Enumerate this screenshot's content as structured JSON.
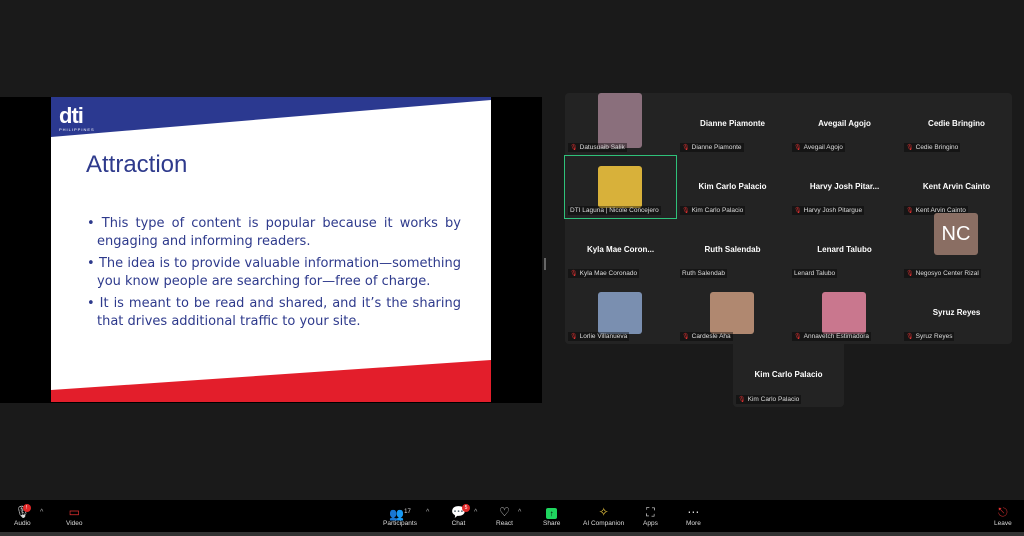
{
  "slide": {
    "logo": "dti",
    "logo_sub": "PHILIPPINES",
    "title": "Attraction",
    "bullets": [
      "This type of content is popular because it works by engaging and informing readers.",
      "The idea is to provide valuable information—something you know people are searching for—free of charge.",
      "It is meant to be read and shared, and it’s the sharing that drives additional traffic to your site."
    ]
  },
  "gallery": [
    {
      "big": "",
      "label": "Datusuaib Salik",
      "muted": true,
      "photo": "#8a6f7c"
    },
    {
      "big": "Dianne Piamonte",
      "label": "Dianne Piamonte",
      "muted": true
    },
    {
      "big": "Avegail Agojo",
      "label": "Avegail Agojo",
      "muted": true
    },
    {
      "big": "Cedie Bringino",
      "label": "Cedie Bringino",
      "muted": true
    },
    {
      "big": "",
      "label": "DTI Laguna | Nicole Concejero",
      "muted": false,
      "photo": "#d8b13a",
      "active": true
    },
    {
      "big": "Kim Carlo Palacio",
      "label": "Kim Carlo Palacio",
      "muted": true
    },
    {
      "big": "Harvy Josh Pitar...",
      "label": "Harvy Josh Pitargue",
      "muted": true
    },
    {
      "big": "Kent Arvin Cainto",
      "label": "Kent Arvin Cainto",
      "muted": true
    },
    {
      "big": "Kyla Mae Coron...",
      "label": "Kyla Mae Coronado",
      "muted": true
    },
    {
      "big": "Ruth Salendab",
      "label": "Ruth Salendab",
      "muted": false
    },
    {
      "big": "Lenard Talubo",
      "label": "Lenard Talubo",
      "muted": false
    },
    {
      "big": "",
      "label": "Negosyo Center Rizal",
      "muted": true,
      "initials": "NC"
    },
    {
      "big": "",
      "label": "Lorlie Villanueva",
      "muted": true,
      "photo": "#7a8fb0"
    },
    {
      "big": "",
      "label": "Cardesle Aha",
      "muted": true,
      "photo": "#b08870"
    },
    {
      "big": "",
      "label": "Annavetch Estimadora",
      "muted": true,
      "photo": "#c9778e"
    },
    {
      "big": "Syruz Reyes",
      "label": "Syruz Reyes",
      "muted": true
    }
  ],
  "extra_tile": {
    "big": "Kim Carlo Palacio",
    "label": "Kim Carlo Palacio"
  },
  "toolbar": {
    "audio": "Audio",
    "video": "Video",
    "participants": "Participants",
    "participant_count": "17",
    "chat": "Chat",
    "chat_badge": "5",
    "react": "React",
    "share": "Share",
    "ai": "AI Companion",
    "apps": "Apps",
    "more": "More",
    "leave": "Leave"
  },
  "colors": {
    "share": "#1fd65f",
    "mute": "#e03030",
    "active": "#2fc17a",
    "slide_blue": "#2e3a8c",
    "slide_red": "#e31e2b"
  }
}
